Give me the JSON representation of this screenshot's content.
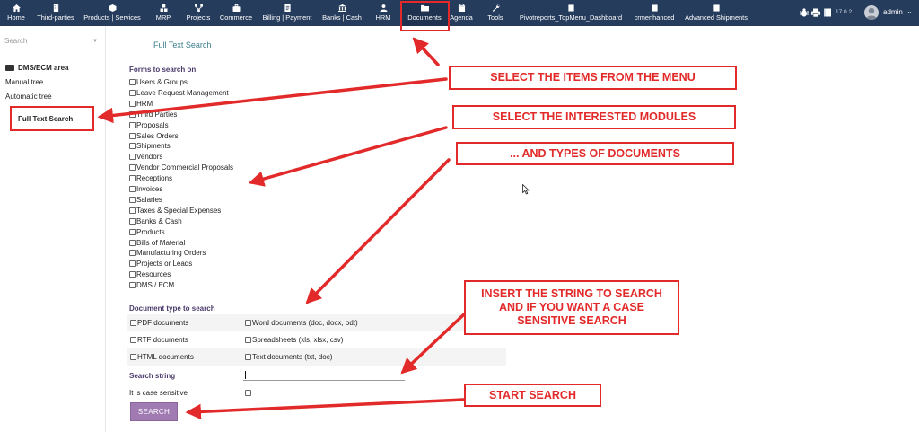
{
  "topmenu": {
    "items": [
      {
        "label": "Home",
        "icon": "home-icon"
      },
      {
        "label": "Third-parties",
        "icon": "building-icon"
      },
      {
        "label": "Products | Services",
        "icon": "cube-icon"
      },
      {
        "label": "MRP",
        "icon": "cubes-icon"
      },
      {
        "label": "Projects",
        "icon": "sitemap-icon"
      },
      {
        "label": "Commerce",
        "icon": "suitcase-icon"
      },
      {
        "label": "Billing | Payment",
        "icon": "invoice-icon"
      },
      {
        "label": "Banks | Cash",
        "icon": "bank-icon"
      },
      {
        "label": "HRM",
        "icon": "user-icon"
      },
      {
        "label": "Documents",
        "icon": "folder-icon"
      },
      {
        "label": "Agenda",
        "icon": "calendar-icon"
      },
      {
        "label": "Tools",
        "icon": "wrench-icon"
      },
      {
        "label": "Pivotreports_TopMenu_Dashboard",
        "icon": "doc-icon"
      },
      {
        "label": "crmenhanced",
        "icon": "doc-icon"
      },
      {
        "label": "Advanced Shipments",
        "icon": "doc-icon"
      }
    ],
    "active": "Documents",
    "version": "17.0.2",
    "user": "admin"
  },
  "sidebar": {
    "search_placeholder": "Search",
    "area_title": "DMS/ECM area",
    "links": [
      "Manual tree",
      "Automatic tree",
      "Full Text Search"
    ]
  },
  "content": {
    "title": "Full Text Search",
    "forms_title": "Forms to search on",
    "forms": [
      "Users & Groups",
      "Leave Request Management",
      "HRM",
      "Third Parties",
      "Proposals",
      "Sales Orders",
      "Shipments",
      "Vendors",
      "Vendor Commercial Proposals",
      "Receptions",
      "Invoices",
      "Salaries",
      "Taxes & Special Expenses",
      "Banks & Cash",
      "Products",
      "Bills of Material",
      "Manufacturing Orders",
      "Projects or Leads",
      "Resources",
      "DMS / ECM"
    ],
    "doctype_title": "Document type to search",
    "doctypes": [
      [
        "PDF documents",
        "Word documents (doc, docx, odt)"
      ],
      [
        "RTF documents",
        "Spreadsheets (xls, xlsx, csv)"
      ],
      [
        "HTML documents",
        "Text documents (txt, doc)"
      ]
    ],
    "search_string_label": "Search string",
    "search_string_value": "",
    "case_label": "It is case sensitive",
    "search_button": "SEARCH"
  },
  "callouts": {
    "c1": "SELECT THE ITEMS FROM THE MENU",
    "c2": "SELECT THE INTERESTED MODULES",
    "c3": "... AND TYPES OF DOCUMENTS",
    "c4": "INSERT THE STRING TO SEARCH AND IF YOU WANT A CASE SENSITIVE SEARCH",
    "c5": "START SEARCH"
  },
  "colors": {
    "topbar": "#263c5c",
    "callout_red": "#e32a2a",
    "button_purple": "#a07bb2",
    "title_teal": "#3a7d8c"
  }
}
